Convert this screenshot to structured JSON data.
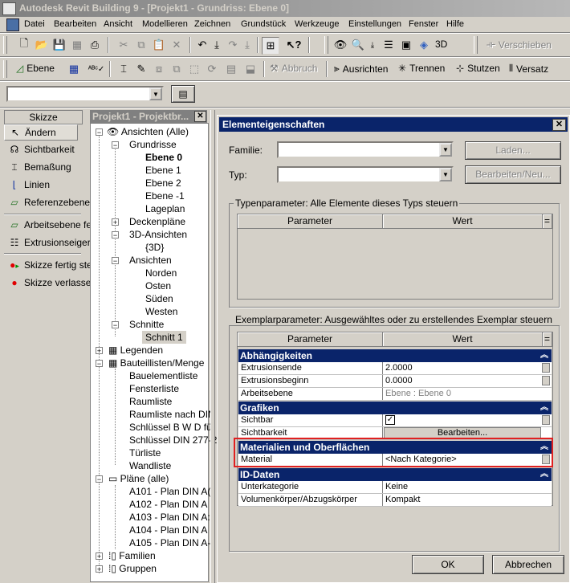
{
  "app": {
    "title": "Autodesk Revit Building 9 - [Projekt1 - Grundriss: Ebene 0]"
  },
  "menu": [
    "Datei",
    "Bearbeiten",
    "Ansicht",
    "Modellieren",
    "Zeichnen",
    "Grundstück",
    "Werkzeuge",
    "Einstellungen",
    "Fenster",
    "Hilfe"
  ],
  "toolbar1": {
    "label_3d": "3D",
    "verschieben": "Verschieben"
  },
  "toolbar2": {
    "ebene": "Ebene",
    "abbruch": "Abbruch",
    "ausrichten": "Ausrichten",
    "trennen": "Trennen",
    "stutzen": "Stutzen",
    "versatz": "Versatz"
  },
  "skizze": {
    "header": "Skizze",
    "items": [
      "Ändern",
      "Sichtbarkeit",
      "Bemaßung",
      "Linien",
      "Referenzebene",
      "Arbeitsebene fe",
      "Extrusionseiger",
      "Skizze fertig ste",
      "Skizze verlasse"
    ]
  },
  "browser": {
    "header": "Projekt1 - Projektbr...",
    "nodes": [
      "Ansichten (Alle)",
      "Grundrisse",
      "Ebene 0",
      "Ebene 1",
      "Ebene 2",
      "Ebene -1",
      "Lageplan",
      "Deckenpläne",
      "3D-Ansichten",
      "{3D}",
      "Ansichten",
      "Norden",
      "Osten",
      "Süden",
      "Westen",
      "Schnitte",
      "Schnitt 1",
      "Legenden",
      "Bauteillisten/Menge",
      "Bauelementliste",
      "Fensterliste",
      "Raumliste",
      "Raumliste nach DIN",
      "Schlüssel B W D für",
      "Schlüssel DIN 277-2",
      "Türliste",
      "Wandliste",
      "Pläne (alle)",
      "A101 - Plan DIN A(",
      "A102 - Plan DIN A",
      "A103 - Plan DIN A:",
      "A104 - Plan DIN A",
      "A105 - Plan DIN A-",
      "Familien",
      "Gruppen"
    ]
  },
  "dialog": {
    "title": "Elementeigenschaften",
    "familie_label": "Familie:",
    "typ_label": "Typ:",
    "laden": "Laden...",
    "bearbeiten_neu": "Bearbeiten/Neu...",
    "typparam_label": "Typenparameter: Alle Elemente dieses Typs steuern",
    "exemplar_label": "Exemplarparameter: Ausgewähltes oder zu erstellendes Exemplar steuern",
    "col_parameter": "Parameter",
    "col_wert": "Wert",
    "col_eq": "=",
    "categories": [
      {
        "name": "Abhängigkeiten",
        "rows": [
          [
            "Extrusionsende",
            "2.0000"
          ],
          [
            "Extrusionsbeginn",
            "0.0000"
          ],
          [
            "Arbeitsebene",
            "Ebene : Ebene 0"
          ]
        ]
      },
      {
        "name": "Grafiken",
        "rows": [
          [
            "Sichtbar",
            ""
          ],
          [
            "Sichtbarkeit",
            "Bearbeiten..."
          ]
        ]
      },
      {
        "name": "Materialien und Oberflächen",
        "rows": [
          [
            "Material",
            "<Nach Kategorie>"
          ]
        ]
      },
      {
        "name": "ID-Daten",
        "rows": [
          [
            "Unterkategorie",
            "Keine"
          ],
          [
            "Volumenkörper/Abzugskörper",
            "Kompakt"
          ]
        ]
      }
    ],
    "ok": "OK",
    "abbrechen": "Abbrechen",
    "highlight_color": "#e02020"
  }
}
